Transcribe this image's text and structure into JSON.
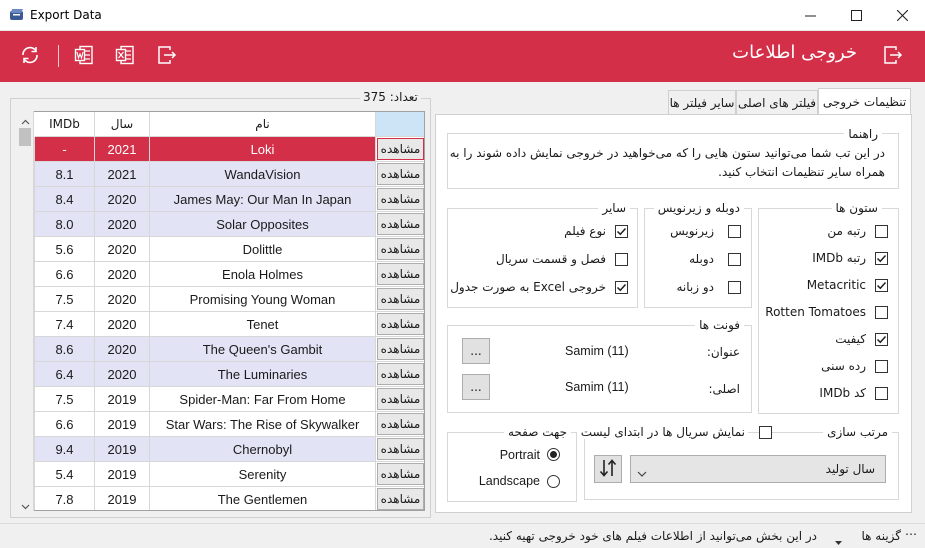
{
  "window": {
    "title": "Export Data",
    "minimize_icon": "minimize-icon",
    "maximize_icon": "maximize-icon",
    "close_icon": "close-icon"
  },
  "header": {
    "title": "خروجی اطلاعات",
    "background": "#d42f48",
    "tool_icons": [
      "refresh-icon",
      "word-export-icon",
      "excel-export-icon",
      "exit-icon"
    ],
    "title_icon": "exit-icon"
  },
  "grid": {
    "count_label": "تعداد: 375",
    "columns": {
      "action": "",
      "name": "نام",
      "year": "سال",
      "imdb": "IMDb"
    },
    "view_label": "مشاهده",
    "rows": [
      {
        "name": "Loki",
        "year": "2021",
        "imdb": "-",
        "selected": true
      },
      {
        "name": "WandaVision",
        "year": "2021",
        "imdb": "8.1",
        "tint": true
      },
      {
        "name": "James May: Our Man In Japan",
        "year": "2020",
        "imdb": "8.4",
        "tint": true
      },
      {
        "name": "Solar Opposites",
        "year": "2020",
        "imdb": "8.0",
        "tint": true
      },
      {
        "name": "Dolittle",
        "year": "2020",
        "imdb": "5.6",
        "tint": false
      },
      {
        "name": "Enola Holmes",
        "year": "2020",
        "imdb": "6.6",
        "tint": false
      },
      {
        "name": "Promising Young Woman",
        "year": "2020",
        "imdb": "7.5",
        "tint": false
      },
      {
        "name": "Tenet",
        "year": "2020",
        "imdb": "7.4",
        "tint": false
      },
      {
        "name": "The Queen's Gambit",
        "year": "2020",
        "imdb": "8.6",
        "tint": true
      },
      {
        "name": "The Luminaries",
        "year": "2020",
        "imdb": "6.4",
        "tint": true
      },
      {
        "name": "Spider-Man: Far From Home",
        "year": "2019",
        "imdb": "7.5",
        "tint": false
      },
      {
        "name": "Star Wars: The Rise of Skywalker",
        "year": "2019",
        "imdb": "6.6",
        "tint": false
      },
      {
        "name": "Chernobyl",
        "year": "2019",
        "imdb": "9.4",
        "tint": true
      },
      {
        "name": "Serenity",
        "year": "2019",
        "imdb": "5.4",
        "tint": false
      },
      {
        "name": "The Gentlemen",
        "year": "2019",
        "imdb": "7.8",
        "tint": false
      }
    ],
    "selected_color": "#d42f48",
    "tint_color": "#e2e4f6"
  },
  "tabs": [
    {
      "label": "تنظیمات خروجی",
      "active": true
    },
    {
      "label": "فیلتر های اصلی",
      "active": false
    },
    {
      "label": "سایر فیلتر ها",
      "active": false
    }
  ],
  "guide": {
    "title": "راهنما",
    "line1": "در این تب شما می‌توانید ستون هایی را که می‌خواهید در خروجی نمایش داده شوند را به",
    "line2": "همراه سایر تنظیمات انتخاب کنید."
  },
  "columns_group": {
    "title": "ستون ها",
    "items": [
      {
        "label": "رتبه من",
        "checked": false
      },
      {
        "label": "رتبه IMDb",
        "checked": true
      },
      {
        "label": "Metacritic",
        "checked": true
      },
      {
        "label": "Rotten Tomatoes",
        "checked": false
      },
      {
        "label": "کیفیت",
        "checked": true
      },
      {
        "label": "رده سنی",
        "checked": false
      },
      {
        "label": "کد IMDb",
        "checked": false
      }
    ]
  },
  "dub_group": {
    "title": "دوبله و زیرنویس",
    "items": [
      {
        "label": "زیرنویس",
        "checked": false
      },
      {
        "label": "دوبله",
        "checked": false
      },
      {
        "label": "دو زبانه",
        "checked": false
      }
    ]
  },
  "other_group": {
    "title": "سایر",
    "items": [
      {
        "label": "نوع فیلم",
        "checked": true
      },
      {
        "label": "فصل و قسمت سریال",
        "checked": false
      },
      {
        "label": "خروجی Excel به صورت جدول",
        "checked": true
      }
    ]
  },
  "fonts_group": {
    "title": "فونت ها",
    "title_font_label": "عنوان:",
    "title_font_value": "Samim (11)",
    "body_font_label": "اصلی:",
    "body_font_value": "Samim (11)",
    "browse_label": "..."
  },
  "orientation_group": {
    "title": "جهت صفحه",
    "portrait": "Portrait",
    "landscape": "Landscape",
    "selected": "Portrait"
  },
  "sort_group": {
    "title": "مرتب سازی",
    "series_first_label": "نمایش سریال ها در ابتدای لیست",
    "series_first_checked": false,
    "sort_value": "سال تولید",
    "sort_icon": "sort-direction-icon"
  },
  "status": {
    "options_label": "گزینه ها",
    "message": "در این بخش می‌توانید از اطلاعات فیلم های خود خروجی تهیه کنید."
  }
}
